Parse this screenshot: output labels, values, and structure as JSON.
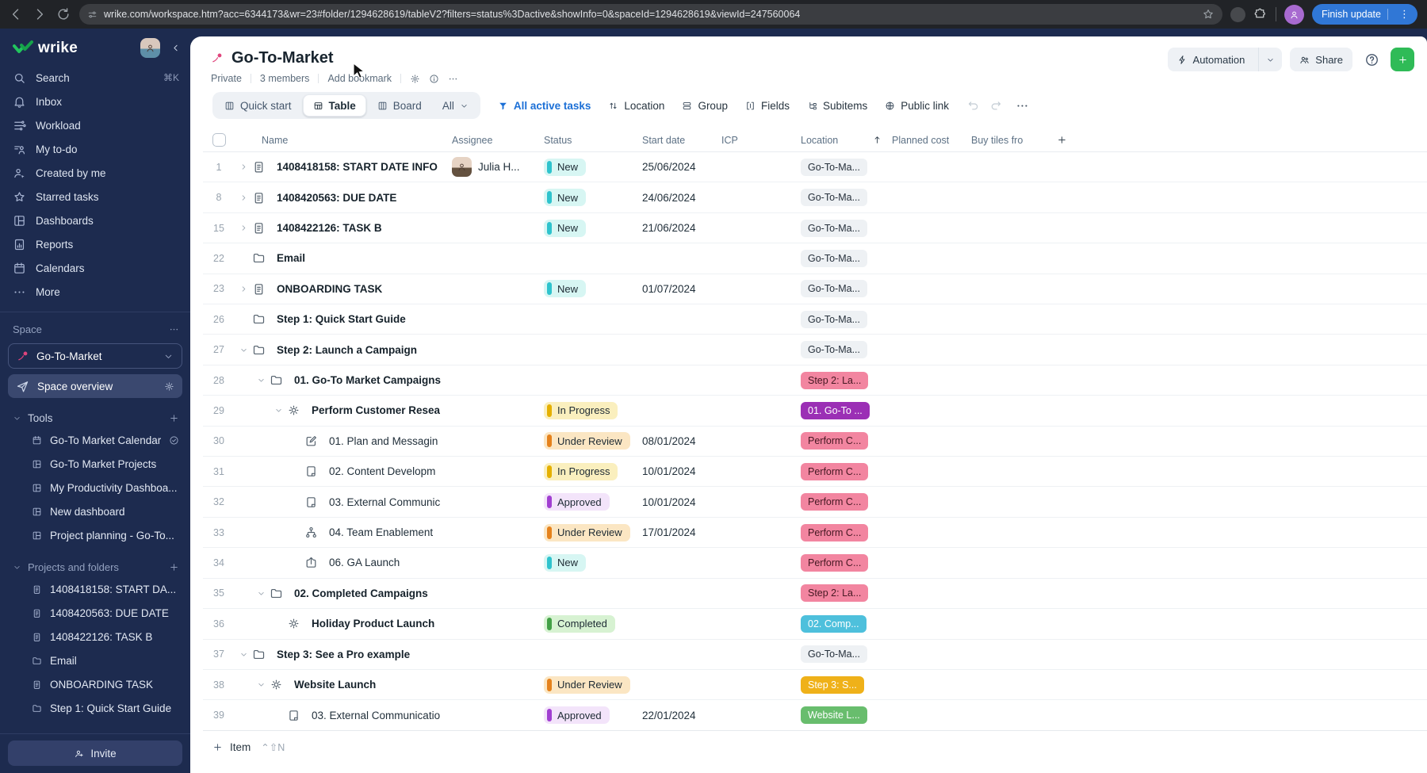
{
  "browser": {
    "url": "wrike.com/workspace.htm?acc=6344173&wr=23#folder/1294628619/tableV2?filters=status%3Dactive&showInfo=0&spaceId=1294628619&viewId=247560064",
    "update_button": "Finish update"
  },
  "sidebar": {
    "logo_text": "wrike",
    "nav": [
      {
        "icon": "search",
        "label": "Search",
        "shortcut": "⌘K"
      },
      {
        "icon": "bell",
        "label": "Inbox"
      },
      {
        "icon": "workload",
        "label": "Workload"
      },
      {
        "icon": "todo",
        "label": "My to-do"
      },
      {
        "icon": "created",
        "label": "Created by me"
      },
      {
        "icon": "star",
        "label": "Starred tasks"
      },
      {
        "icon": "dashboard",
        "label": "Dashboards"
      },
      {
        "icon": "report",
        "label": "Reports"
      },
      {
        "icon": "calendar",
        "label": "Calendars"
      },
      {
        "icon": "dots",
        "label": "More"
      }
    ],
    "space_label": "Space",
    "space_name": "Go-To-Market",
    "overview_label": "Space overview",
    "tools_label": "Tools",
    "tools": [
      {
        "icon": "calendar",
        "label": "Go-To Market Calendar",
        "trailing": "check"
      },
      {
        "icon": "dashboard",
        "label": "Go-To Market Projects"
      },
      {
        "icon": "dashboard",
        "label": "My Productivity Dashboa..."
      },
      {
        "icon": "dashboard",
        "label": "New dashboard"
      },
      {
        "icon": "dashboard",
        "label": "Project planning - Go-To..."
      }
    ],
    "projects_label": "Projects and folders",
    "projects": [
      {
        "icon": "task",
        "label": "1408418158: START DA..."
      },
      {
        "icon": "task",
        "label": "1408420563: DUE DATE"
      },
      {
        "icon": "task",
        "label": "1408422126: TASK B"
      },
      {
        "icon": "folder",
        "label": "Email"
      },
      {
        "icon": "task",
        "label": "ONBOARDING TASK"
      },
      {
        "icon": "folder",
        "label": "Step 1: Quick Start Guide"
      }
    ],
    "invite_label": "Invite"
  },
  "header": {
    "title": "Go-To-Market",
    "meta": [
      "Private",
      "3 members",
      "Add bookmark"
    ],
    "automation_label": "Automation",
    "share_label": "Share"
  },
  "toolbar": {
    "views": [
      "Quick start",
      "Table",
      "Board"
    ],
    "active_view": "Table",
    "scope_label": "All",
    "filter_label": "All active tasks",
    "sort_label": "Location",
    "group_label": "Group",
    "fields_label": "Fields",
    "subitems_label": "Subitems",
    "public_link_label": "Public link"
  },
  "table": {
    "columns": {
      "name": "Name",
      "assignee": "Assignee",
      "status": "Status",
      "start_date": "Start date",
      "icp": "ICP",
      "location": "Location",
      "planned_cost": "Planned cost",
      "buy_tiles": "Buy tiles fro"
    },
    "rows": [
      {
        "num": "1",
        "indent": 0,
        "expand": "closed",
        "icon": "task",
        "bold": true,
        "name": "1408418158: START DATE INFO",
        "assignee": "Julia H...",
        "status": "New",
        "status_key": "new",
        "date": "25/06/2024",
        "location": "Go-To-Ma...",
        "location_color": "gray"
      },
      {
        "num": "8",
        "indent": 0,
        "expand": "closed",
        "icon": "task",
        "bold": true,
        "name": "1408420563: DUE DATE",
        "status": "New",
        "status_key": "new",
        "date": "24/06/2024",
        "location": "Go-To-Ma...",
        "location_color": "gray"
      },
      {
        "num": "15",
        "indent": 0,
        "expand": "closed",
        "icon": "task",
        "bold": true,
        "name": "1408422126: TASK B",
        "status": "New",
        "status_key": "new",
        "date": "21/06/2024",
        "location": "Go-To-Ma...",
        "location_color": "gray"
      },
      {
        "num": "22",
        "indent": 0,
        "expand": null,
        "icon": "folder",
        "bold": true,
        "name": "Email",
        "location": "Go-To-Ma...",
        "location_color": "gray"
      },
      {
        "num": "23",
        "indent": 0,
        "expand": "closed",
        "icon": "task",
        "bold": true,
        "name": "ONBOARDING TASK",
        "status": "New",
        "status_key": "new",
        "date": "01/07/2024",
        "location": "Go-To-Ma...",
        "location_color": "gray"
      },
      {
        "num": "26",
        "indent": 0,
        "expand": null,
        "icon": "folder",
        "bold": true,
        "name": "Step 1: Quick Start Guide",
        "location": "Go-To-Ma...",
        "location_color": "gray"
      },
      {
        "num": "27",
        "indent": 0,
        "expand": "open",
        "icon": "folder",
        "bold": true,
        "name": "Step 2: Launch a Campaign",
        "location": "Go-To-Ma...",
        "location_color": "gray"
      },
      {
        "num": "28",
        "indent": 1,
        "expand": "open",
        "icon": "folder",
        "bold": true,
        "name": "01. Go-To Market Campaigns",
        "location": "Step 2: La...",
        "location_color": "pink"
      },
      {
        "num": "29",
        "indent": 2,
        "expand": "open",
        "icon": "sun",
        "bold": true,
        "name": "Perform Customer Resea",
        "status": "In Progress",
        "status_key": "inprogress",
        "location": "01. Go-To ...",
        "location_color": "purple"
      },
      {
        "num": "30",
        "indent": 3,
        "expand": null,
        "icon": "edit",
        "bold": false,
        "name": "01. Plan and Messagin",
        "status": "Under Review",
        "status_key": "review",
        "date": "08/01/2024",
        "location": "Perform C...",
        "location_color": "pink"
      },
      {
        "num": "31",
        "indent": 3,
        "expand": null,
        "icon": "page",
        "bold": false,
        "name": "02. Content Developm",
        "status": "In Progress",
        "status_key": "inprogress",
        "date": "10/01/2024",
        "location": "Perform C...",
        "location_color": "pink"
      },
      {
        "num": "32",
        "indent": 3,
        "expand": null,
        "icon": "page",
        "bold": false,
        "name": "03. External Communic",
        "status": "Approved",
        "status_key": "approved",
        "date": "10/01/2024",
        "location": "Perform C...",
        "location_color": "pink"
      },
      {
        "num": "33",
        "indent": 3,
        "expand": null,
        "icon": "team",
        "bold": false,
        "name": "04. Team Enablement",
        "status": "Under Review",
        "status_key": "review",
        "date": "17/01/2024",
        "location": "Perform C...",
        "location_color": "pink"
      },
      {
        "num": "34",
        "indent": 3,
        "expand": null,
        "icon": "launch",
        "bold": false,
        "name": "06. GA Launch",
        "status": "New",
        "status_key": "new",
        "location": "Perform C...",
        "location_color": "pink"
      },
      {
        "num": "35",
        "indent": 1,
        "expand": "open",
        "icon": "folder",
        "bold": true,
        "name": "02. Completed Campaigns",
        "location": "Step 2: La...",
        "location_color": "pink"
      },
      {
        "num": "36",
        "indent": 2,
        "expand": null,
        "icon": "sun",
        "bold": true,
        "name": "Holiday Product Launch",
        "status": "Completed",
        "status_key": "completed",
        "location": "02. Comp...",
        "location_color": "cyan"
      },
      {
        "num": "37",
        "indent": 0,
        "expand": "open",
        "icon": "folder",
        "bold": true,
        "name": "Step 3: See a Pro example",
        "location": "Go-To-Ma...",
        "location_color": "gray"
      },
      {
        "num": "38",
        "indent": 1,
        "expand": "open",
        "icon": "sun",
        "bold": true,
        "name": "Website Launch",
        "status": "Under Review",
        "status_key": "review",
        "location": "Step 3: S...",
        "location_color": "amber"
      },
      {
        "num": "39",
        "indent": 2,
        "expand": null,
        "icon": "page",
        "bold": false,
        "name": "03. External Communicatio",
        "status": "Approved",
        "status_key": "approved",
        "date": "22/01/2024",
        "location": "Website L...",
        "location_color": "green"
      }
    ]
  },
  "footer": {
    "item_label": "Item",
    "shortcut": "⌃⇧N"
  },
  "colors": {
    "accent_blue": "#1b6fd6",
    "green_add": "#2fbb57",
    "sidebar_bg": "#1d2b4f",
    "status": {
      "new": "#2fc3cd",
      "inprogress": "#e5b000",
      "review": "#e5821c",
      "approved": "#a13fd1",
      "completed": "#43a047"
    },
    "location": {
      "gray": "#eef1f4",
      "pink": "#f285a0",
      "purple": "#9b2fb5",
      "cyan": "#4ec0dc",
      "amber": "#efb119",
      "green": "#68bd6d"
    }
  }
}
